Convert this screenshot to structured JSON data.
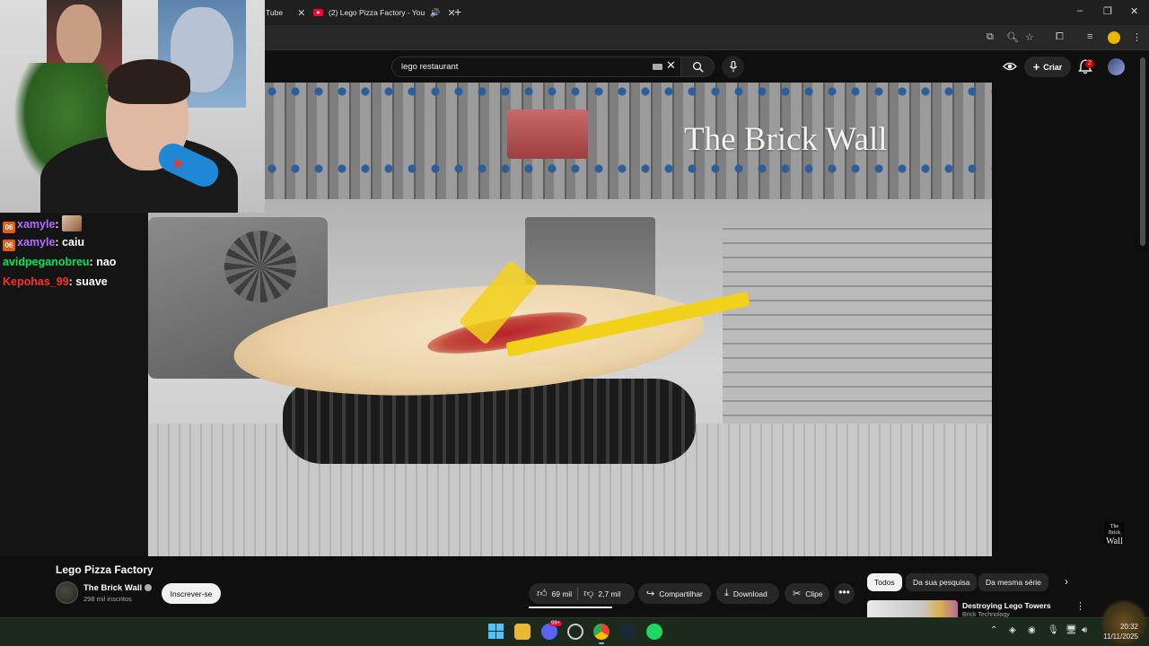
{
  "browser": {
    "tabs": [
      {
        "label": "Tube",
        "active": false
      },
      {
        "label": "(2) Lego Pizza Factory - You",
        "active": true
      }
    ],
    "window_controls": [
      "–",
      "❐",
      "✕"
    ]
  },
  "youtube": {
    "search": {
      "value": "lego restaurant"
    },
    "create_label": "Criar",
    "notifications_count": "2"
  },
  "video": {
    "watermark_title": "The Brick Wall",
    "corner_logo_small": "The Brick",
    "corner_logo_big": "Wall"
  },
  "chat": {
    "messages": [
      {
        "user": "xamyle",
        "text": "",
        "color": "#b36cff",
        "badge": "06",
        "emote": true
      },
      {
        "user": "xamyle",
        "text": "caiu",
        "color": "#b36cff",
        "badge": "06",
        "emote": false
      },
      {
        "user": "avidpeganobreu",
        "text": "nao",
        "color": "#00e65c",
        "badge": "",
        "emote": false
      },
      {
        "user": "Kepohas_99",
        "text": "suave",
        "color": "#ff2d2d",
        "badge": "",
        "emote": false
      }
    ]
  },
  "info": {
    "title": "Lego Pizza Factory",
    "channel": "The Brick Wall",
    "subscribers": "298 mil inscritos",
    "subscribe_label": "Inscrever-se",
    "likes": "69 mil",
    "dislikes": "2,7 mil",
    "share_label": "Compartilhar",
    "download_label": "Download",
    "clip_label": "Clipe",
    "more_label": "•••"
  },
  "recommendations": {
    "chips": [
      {
        "label": "Todos",
        "active": true
      },
      {
        "label": "Da sua pesquisa",
        "active": false
      },
      {
        "label": "Da mesma série",
        "active": false
      }
    ],
    "items": [
      {
        "title": "Destroying Lego Towers",
        "channel": "Brick Technology"
      }
    ]
  },
  "taskbar": {
    "time": "20:32",
    "date": "11/11/2025",
    "chat_badge": "99+"
  },
  "colors": {
    "accent_red": "#ff0033",
    "lego_yellow": "#f2d11a",
    "badge_orange": "#e35d14"
  }
}
